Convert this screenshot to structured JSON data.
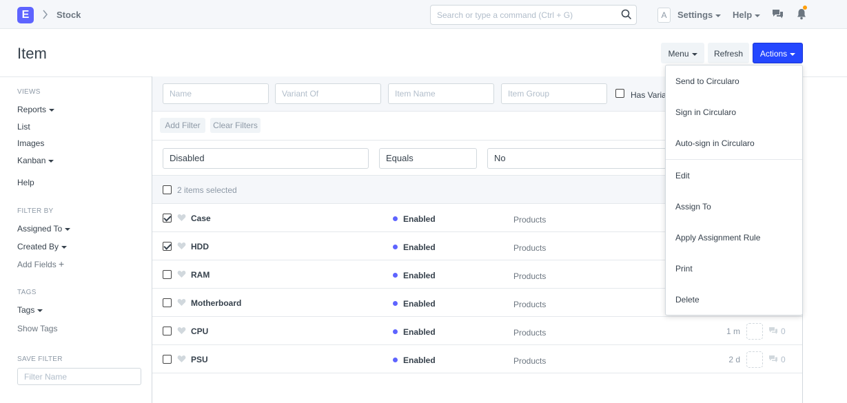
{
  "navbar": {
    "logo_letter": "E",
    "breadcrumb": "Stock",
    "search_placeholder": "Search or type a command (Ctrl + G)",
    "avatar_letter": "A",
    "settings_label": "Settings",
    "help_label": "Help"
  },
  "page": {
    "title": "Item",
    "menu_label": "Menu",
    "refresh_label": "Refresh",
    "actions_label": "Actions"
  },
  "sidebar": {
    "views_title": "VIEWS",
    "reports": "Reports",
    "list": "List",
    "images": "Images",
    "kanban": "Kanban",
    "help": "Help",
    "filter_by_title": "FILTER BY",
    "assigned_to": "Assigned To",
    "created_by": "Created By",
    "add_fields": "Add Fields",
    "tags_title": "TAGS",
    "tags": "Tags",
    "show_tags": "Show Tags",
    "save_filter_title": "SAVE FILTER",
    "filter_name_placeholder": "Filter Name"
  },
  "standard_filters": {
    "name_placeholder": "Name",
    "variant_of_placeholder": "Variant Of",
    "item_name_placeholder": "Item Name",
    "item_group_placeholder": "Item Group",
    "has_variants_label": "Has Variants"
  },
  "filter_bar": {
    "add_filter": "Add Filter",
    "clear_filters": "Clear Filters"
  },
  "active_filter": {
    "field": "Disabled",
    "condition": "Equals",
    "value": "No"
  },
  "list": {
    "selected_text": "2 items selected",
    "rows": [
      {
        "name": "Case",
        "status": "Enabled",
        "group": "Products",
        "time": "",
        "comments": "",
        "checked": true
      },
      {
        "name": "HDD",
        "status": "Enabled",
        "group": "Products",
        "time": "",
        "comments": "",
        "checked": true
      },
      {
        "name": "RAM",
        "status": "Enabled",
        "group": "Products",
        "time": "",
        "comments": "",
        "checked": false
      },
      {
        "name": "Motherboard",
        "status": "Enabled",
        "group": "Products",
        "time": "",
        "comments": "",
        "checked": false
      },
      {
        "name": "CPU",
        "status": "Enabled",
        "group": "Products",
        "time": "1 m",
        "comments": "0",
        "checked": false
      },
      {
        "name": "PSU",
        "status": "Enabled",
        "group": "Products",
        "time": "2 d",
        "comments": "0",
        "checked": false
      }
    ]
  },
  "actions_menu": {
    "items": [
      "Send to Circularo",
      "Sign in Circularo",
      "Auto-sign in Circularo",
      "Edit",
      "Assign To",
      "Apply Assignment Rule",
      "Print",
      "Delete"
    ]
  },
  "colors": {
    "primary": "#2447ff",
    "brand": "#5e64ff",
    "notification": "#ff9f0a"
  }
}
